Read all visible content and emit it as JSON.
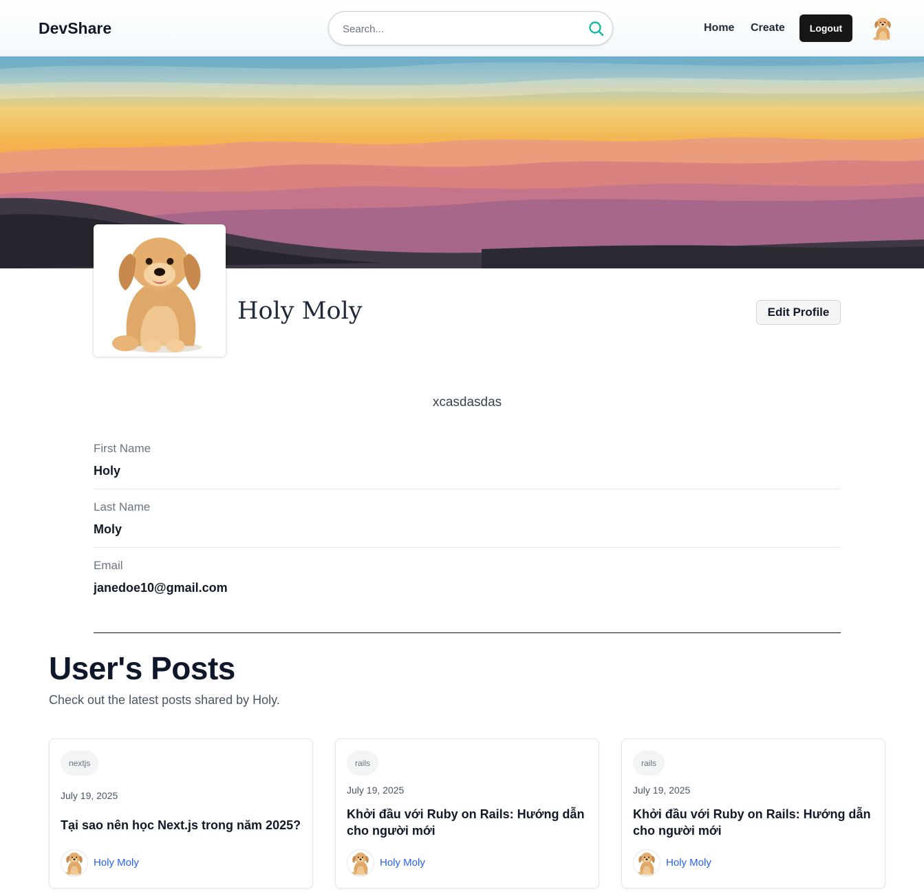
{
  "header": {
    "logo": "DevShare",
    "search_placeholder": "Search...",
    "nav": {
      "home": "Home",
      "create": "Create"
    },
    "logout_label": "Logout"
  },
  "profile": {
    "name": "Holy Moly",
    "edit_label": "Edit Profile",
    "bio": "xcasdasdas",
    "fields": [
      {
        "label": "First Name",
        "value": "Holy"
      },
      {
        "label": "Last Name",
        "value": "Moly"
      },
      {
        "label": "Email",
        "value": "janedoe10@gmail.com"
      }
    ]
  },
  "posts": {
    "title": "User's Posts",
    "subtitle": "Check out the latest posts shared by Holy.",
    "items": [
      {
        "tag": "nextjs",
        "date": "July 19, 2025",
        "title": "Tại sao nên học Next.js trong năm 2025?",
        "author": "Holy Moly"
      },
      {
        "tag": "rails",
        "date": "July 19, 2025",
        "title": "Khởi đầu với Ruby on Rails: Hướng dẫn cho người mới",
        "author": "Holy Moly"
      },
      {
        "tag": "rails",
        "date": "July 19, 2025",
        "title": "Khởi đầu với Ruby on Rails: Hướng dẫn cho người mới",
        "author": "Holy Moly"
      }
    ]
  },
  "colors": {
    "accent_search_icon": "#14b8a6",
    "author_link": "#2563eb",
    "logout_bg": "#161616"
  }
}
